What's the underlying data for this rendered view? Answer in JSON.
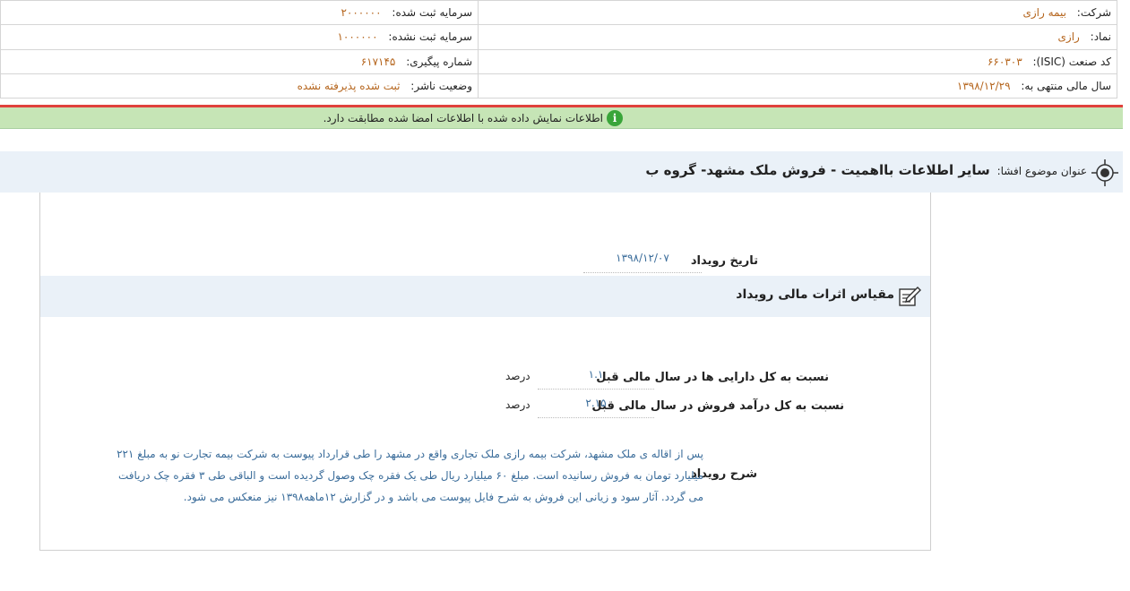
{
  "header": {
    "company_label": "شرکت:",
    "company_value": "بیمه رازی",
    "symbol_label": "نماد:",
    "symbol_value": "رازی",
    "isic_label": "کد صنعت (ISIC):",
    "isic_value": "۶۶۰۳۰۳",
    "fiscal_label": "سال مالی منتهی به:",
    "fiscal_value": "۱۳۹۸/۱۲/۲۹",
    "reg_capital_label": "سرمایه ثبت شده:",
    "reg_capital_value": "۲۰۰۰۰۰۰",
    "unreg_capital_label": "سرمایه ثبت نشده:",
    "unreg_capital_value": "۱۰۰۰۰۰۰",
    "tracking_label": "شماره پیگیری:",
    "tracking_value": "۶۱۷۱۴۵",
    "publisher_status_label": "وضعیت ناشر:",
    "publisher_status_value": "ثبت شده پذیرفته نشده"
  },
  "notice": {
    "icon": "info-icon",
    "text": "اطلاعات نمایش داده شده با اطلاعات امضا شده مطابقت دارد."
  },
  "subject": {
    "label": "عنوان موضوع افشا:",
    "value": "سایر اطلاعات بااهمیت - فروش ملک مشهد- گروه ب"
  },
  "event": {
    "date_label": "تاریخ رویداد",
    "date_value": "۱۳۹۸/۱۲/۰۷"
  },
  "section": {
    "title": "مقیاس اثرات مالی رویداد"
  },
  "metrics": [
    {
      "label": "نسبت به کل دارایی ها در سال مالی قبل",
      "value": "۱.۱",
      "unit": "درصد"
    },
    {
      "label": "نسبت به کل درآمد فروش در سال مالی قبل",
      "value": "۲.۱۵",
      "unit": "درصد"
    }
  ],
  "description": {
    "label": "شرح رویداد",
    "text": "پس از اقاله ی ملک مشهد، شرکت بیمه رازی ملک تجاری واقع در مشهد را طی قرارداد پیوست به شرکت بیمه تجارت نو به مبلغ ۲۲۱ میلیارد تومان به فروش رسانیده است. مبلغ ۶۰ میلیارد ریال طی یک فقره چک وصول گردیده است و الباقی طی ۳ فقره چک دریافت می گردد. آثار سود و زیانی این فروش به شرح فایل پیوست می باشد و در گزارش ۱۲ماهه۱۳۹۸ نیز منعکس می شود."
  }
}
